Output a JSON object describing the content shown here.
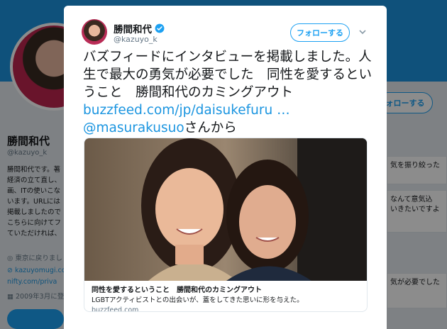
{
  "background": {
    "name": "勝間和代",
    "handle": "@kazuyo_k",
    "bio_lines": [
      "勝間和代です。著",
      "経済の立て直し、",
      "画、ITの使いこな",
      "います。URLには",
      "掲載しましたので",
      "こちらに向けてフ",
      "ていただければ、"
    ],
    "location": "東京に戻りまし",
    "link_1": "kazuyomugi.com",
    "link_2": "nifty.com/priva",
    "joined": "2009年3月に登",
    "follow_label": "ォローする",
    "card_snippets": [
      "気を振り絞った",
      "なんて意気込",
      "いきたいですよ",
      "気が必要でした"
    ]
  },
  "tweet": {
    "author_name": "勝間和代",
    "author_handle": "@kazuyo_k",
    "follow_label": "フォローする",
    "text_main": "バズフィードにインタビューを掲載しました。人生で最大の勇気が必要でした　同性を愛するということ　勝間和代のカミングアウト ",
    "link_text": "buzzfeed.com/jp/daisukefuru …",
    "mention": "@masurakusuo",
    "text_tail": "さんから",
    "card": {
      "title": "同性を愛するということ　勝間和代のカミングアウト",
      "description": "LGBTアクティビストとの出会いが、蓋をしてきた思いに形を与えた。",
      "domain": "buzzfeed.com"
    }
  },
  "colors": {
    "accent": "#1da1f2",
    "link": "#1b95e0",
    "text": "#14171a",
    "muted": "#657786"
  }
}
